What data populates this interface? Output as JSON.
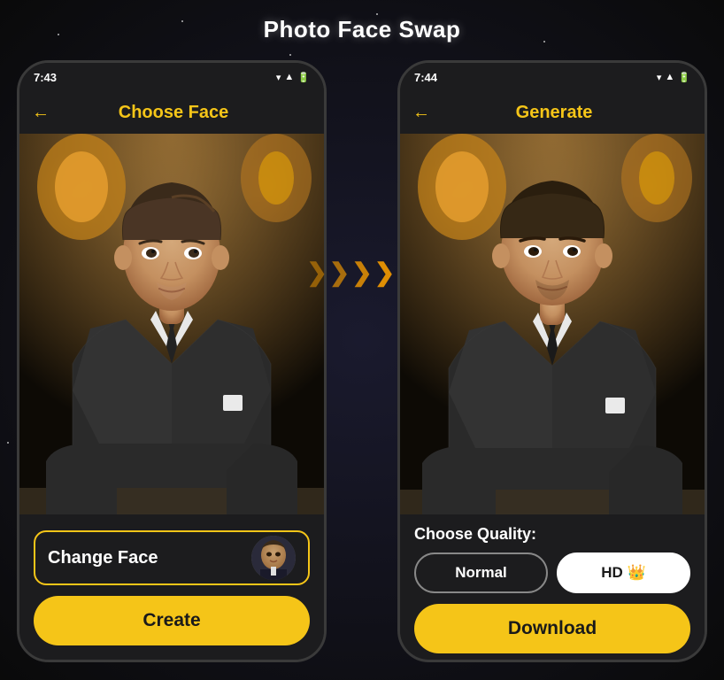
{
  "page": {
    "title": "Photo Face Swap",
    "background_color": "#0a0a0a"
  },
  "left_phone": {
    "status_time": "7:43",
    "header_title": "Choose Face",
    "back_arrow": "←",
    "change_face_label": "Change Face",
    "create_button_label": "Create"
  },
  "right_phone": {
    "status_time": "7:44",
    "header_title": "Generate",
    "back_arrow": "←",
    "quality_title": "Choose Quality:",
    "quality_normal_label": "Normal",
    "quality_hd_label": "HD 👑",
    "download_button_label": "Download"
  },
  "arrows": {
    "symbol": "❯❯❯❯❯"
  }
}
